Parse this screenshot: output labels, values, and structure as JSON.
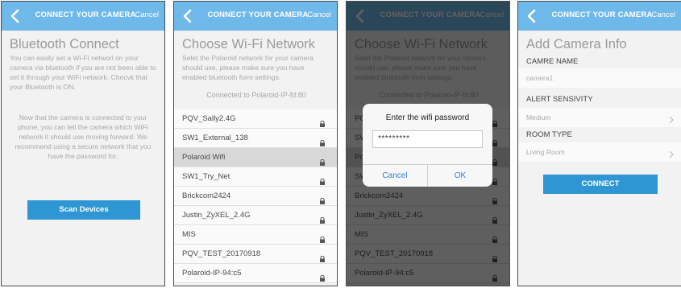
{
  "header": {
    "title": "CONNECT YOUR CAMERA",
    "cancel_label": "Cancel"
  },
  "screen1": {
    "heading": "Bluetooth Connect",
    "intro": "You can easily set a Wi-Fi networl on your camera via bluetooth if you are not been able to set it through your WiFi network. Checvk that your Bluetooth is ON.",
    "info": "Now that the camera is connected to your phone, you can tell the camera which WiFi network it should use moving forward. We recommend using a secure network that you have the password for.",
    "scan_label": "Scan Devices"
  },
  "network": {
    "heading": "Choose Wi-Fi Network",
    "intro": "Selet the Polaroid network for your camera should use, please make sure you have enabled bluetooth form settings.",
    "connected": "Connected to Polaroid-IP-fd:80",
    "networks": [
      "PQV_Sally2.4G",
      "SW1_External_138",
      "Polaroid Wifi",
      "SW1_Try_Net",
      "Brickcom2424",
      "Justin_ZyXEL_2.4G",
      "MIS",
      "PQV_TEST_20170918",
      "Polaroid-IP-94:c5"
    ]
  },
  "dialog": {
    "title": "Enter the wifi password",
    "password": "*********",
    "cancel_label": "Cancel",
    "ok_label": "OK"
  },
  "screen4": {
    "heading": "Add Camera Info",
    "name_label": "CAMRE NAME",
    "name_value": "camera1",
    "alert_label": "ALERT SENSIVITY",
    "alert_value": "Medium",
    "room_label": "ROOM TYPE",
    "room_value": "Living Room",
    "connect_label": "CONNECT"
  },
  "colors": {
    "header": "#6fb8ea",
    "button": "#2e97d3",
    "background": "#f2f2f2"
  },
  "icons": {
    "back": "chevron-left-icon",
    "lock": "lock-icon",
    "chevron": "chevron-right-icon"
  }
}
